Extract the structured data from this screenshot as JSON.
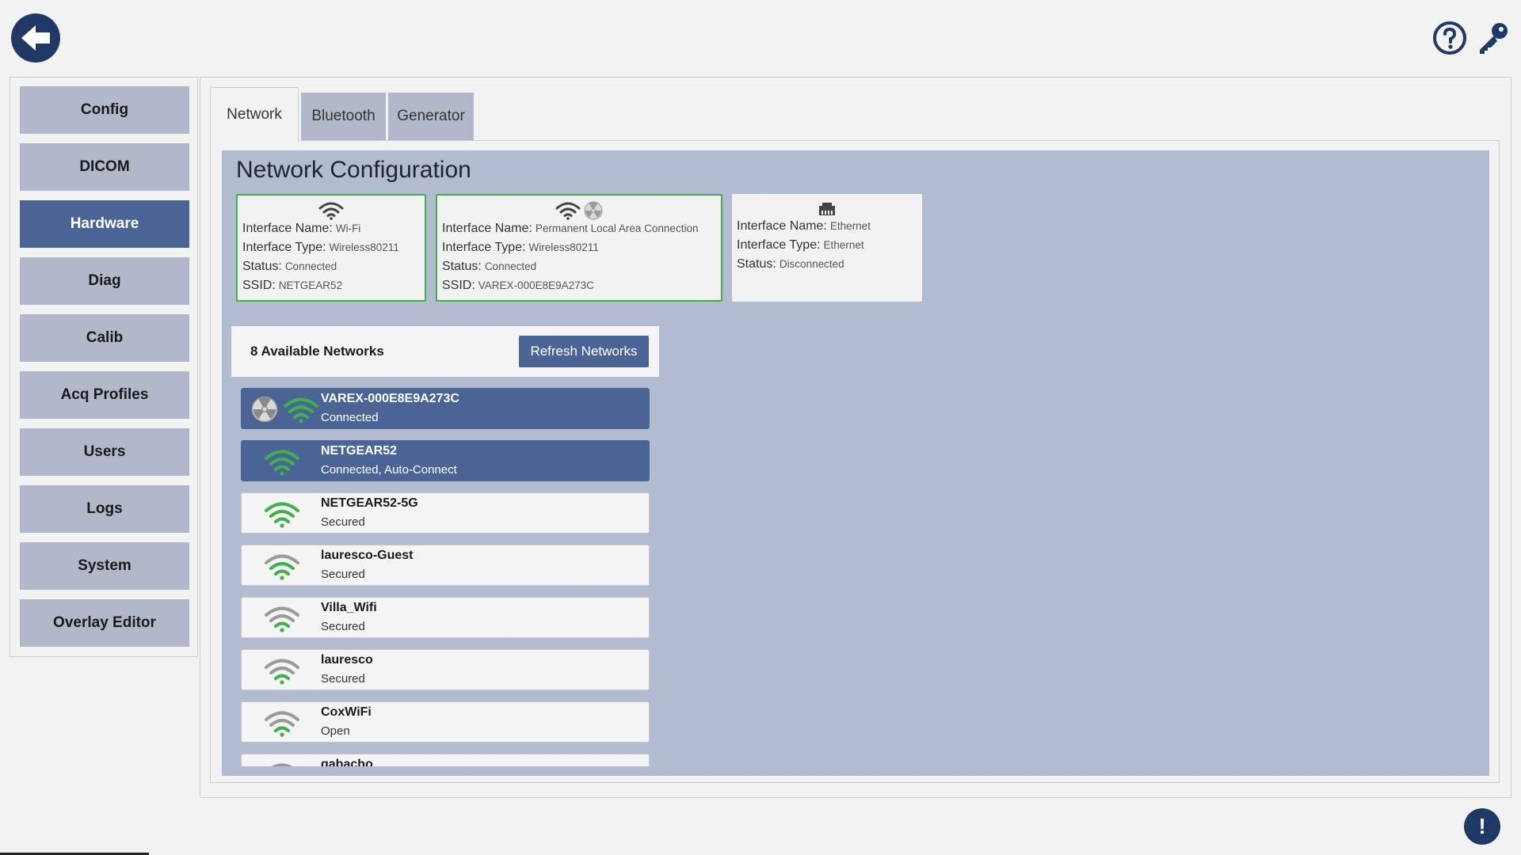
{
  "sidebar": {
    "items": [
      {
        "label": "Config",
        "active": false
      },
      {
        "label": "DICOM",
        "active": false
      },
      {
        "label": "Hardware",
        "active": true
      },
      {
        "label": "Diag",
        "active": false
      },
      {
        "label": "Calib",
        "active": false
      },
      {
        "label": "Acq Profiles",
        "active": false
      },
      {
        "label": "Users",
        "active": false
      },
      {
        "label": "Logs",
        "active": false
      },
      {
        "label": "System",
        "active": false
      },
      {
        "label": "Overlay Editor",
        "active": false
      }
    ]
  },
  "tabs": [
    {
      "label": "Network",
      "active": true
    },
    {
      "label": "Bluetooth",
      "active": false
    },
    {
      "label": "Generator",
      "active": false
    }
  ],
  "network": {
    "title": "Network Configuration",
    "labels": {
      "interface_name": "Interface Name:",
      "interface_type": "Interface Type:",
      "status": "Status:",
      "ssid": "SSID:"
    },
    "interfaces": [
      {
        "icon": "wifi-icon",
        "name": "Wi-Fi",
        "type": "Wireless80211",
        "status": "Connected",
        "ssid": "NETGEAR52",
        "connected": true
      },
      {
        "icon": "wifi-radiation-icon",
        "name": "Permanent Local Area Connection",
        "type": "Wireless80211",
        "status": "Connected",
        "ssid": "VAREX-000E8E9A273C",
        "connected": true
      },
      {
        "icon": "ethernet-icon",
        "name": "Ethernet",
        "type": "Ethernet",
        "status": "Disconnected",
        "connected": false
      }
    ],
    "available_count_label": "8 Available Networks",
    "refresh_label": "Refresh Networks",
    "networks": [
      {
        "name": "VAREX-000E8E9A273C",
        "status": "Connected",
        "selected": true,
        "radiation": true,
        "signal": "strong"
      },
      {
        "name": "NETGEAR52",
        "status": "Connected, Auto-Connect",
        "selected": true,
        "radiation": false,
        "signal": "strong"
      },
      {
        "name": "NETGEAR52-5G",
        "status": "Secured",
        "selected": false,
        "radiation": false,
        "signal": "strong"
      },
      {
        "name": "lauresco-Guest",
        "status": "Secured",
        "selected": false,
        "radiation": false,
        "signal": "medium"
      },
      {
        "name": "Villa_Wifi",
        "status": "Secured",
        "selected": false,
        "radiation": false,
        "signal": "weak"
      },
      {
        "name": "lauresco",
        "status": "Secured",
        "selected": false,
        "radiation": false,
        "signal": "weak"
      },
      {
        "name": "CoxWiFi",
        "status": "Open",
        "selected": false,
        "radiation": false,
        "signal": "weak"
      },
      {
        "name": "gabacho",
        "status": "",
        "selected": false,
        "radiation": false,
        "signal": "weak"
      }
    ]
  },
  "colors": {
    "navy": "#1f3864",
    "active": "#4a6595",
    "inactive": "#b0b8ca",
    "panel": "#b2bbcf",
    "connected_border": "#3fb04a",
    "wifi_green": "#3fb04a",
    "wifi_gray": "#8a8a8a"
  },
  "icons": {
    "back": "back-arrow-icon",
    "help": "help-icon",
    "key": "key-icon",
    "alert": "alert-icon"
  }
}
